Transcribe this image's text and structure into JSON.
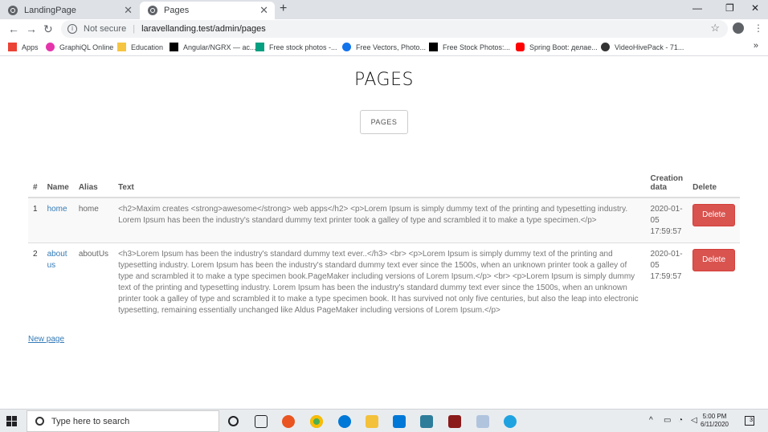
{
  "browser": {
    "tabs": [
      {
        "title": "LandingPage"
      },
      {
        "title": "Pages"
      }
    ],
    "address": {
      "security": "Not secure",
      "url": "laravellanding.test/admin/pages"
    },
    "bookmarks": [
      {
        "label": "Apps",
        "icon": "apps-grid-icon",
        "color": "#ea4335"
      },
      {
        "label": "GraphiQL Online",
        "icon": "graphql-icon",
        "color": "#e535ab"
      },
      {
        "label": "Education",
        "icon": "folder-icon",
        "color": "#f5c542"
      },
      {
        "label": "Angular/NGRX — ac...",
        "icon": "medium-icon",
        "color": "#000000"
      },
      {
        "label": "Free stock photos -...",
        "icon": "pexels-icon",
        "color": "#05a081"
      },
      {
        "label": "Free Vectors, Photo...",
        "icon": "freepik-icon",
        "color": "#1273eb"
      },
      {
        "label": "Free Stock Photos:...",
        "icon": "burst-icon",
        "color": "#000000"
      },
      {
        "label": "Spring Boot: делае...",
        "icon": "youtube-icon",
        "color": "#ff0000"
      },
      {
        "label": "VideoHivePack - 71...",
        "icon": "videohive-icon",
        "color": "#333333"
      }
    ]
  },
  "page": {
    "title": "PAGES",
    "pages_button": "PAGES",
    "table": {
      "headers": {
        "num": "#",
        "name": "Name",
        "alias": "Alias",
        "text": "Text",
        "created": "Creation data",
        "delete": "Delete"
      },
      "rows": [
        {
          "num": "1",
          "name": "home",
          "alias": "home",
          "text": "<h2>Maxim creates <strong>awesome</strong> web apps</h2> <p>Lorem Ipsum is simply dummy text of the printing and typesetting industry. Lorem Ipsum has been the industry's standard dummy text printer took a galley of type and scrambled it to make a type specimen.</p>",
          "created": "2020-01-05 17:59:57",
          "delete": "Delete"
        },
        {
          "num": "2",
          "name": "about us",
          "alias": "aboutUs",
          "text": "<h3>Lorem Ipsum has been the industry's standard dummy text ever..</h3> <br> <p>Lorem Ipsum is simply dummy text of the printing and typesetting industry. Lorem Ipsum has been the industry's standard dummy text ever since the 1500s, when an unknown printer took a galley of type and scrambled it to make a type specimen book.PageMaker including versions of Lorem Ipsum.</p> <br> <p>Lorem Ipsum is simply dummy text of the printing and typesetting industry. Lorem Ipsum has been the industry's standard dummy text ever since the 1500s, when an unknown printer took a galley of type and scrambled it to make a type specimen book. It has survived not only five centuries, but also the leap into electronic typesetting, remaining essentially unchanged like Aldus PageMaker including versions of Lorem Ipsum.</p>",
          "created": "2020-01-05 17:59:57",
          "delete": "Delete"
        }
      ]
    },
    "new_page_link": "New page"
  },
  "taskbar": {
    "search_placeholder": "Type here to search",
    "time": "5:00 PM",
    "date": "6/11/2020",
    "notifications": "3"
  },
  "colors": {
    "link": "#337ab7",
    "delete": "#d9534f"
  }
}
